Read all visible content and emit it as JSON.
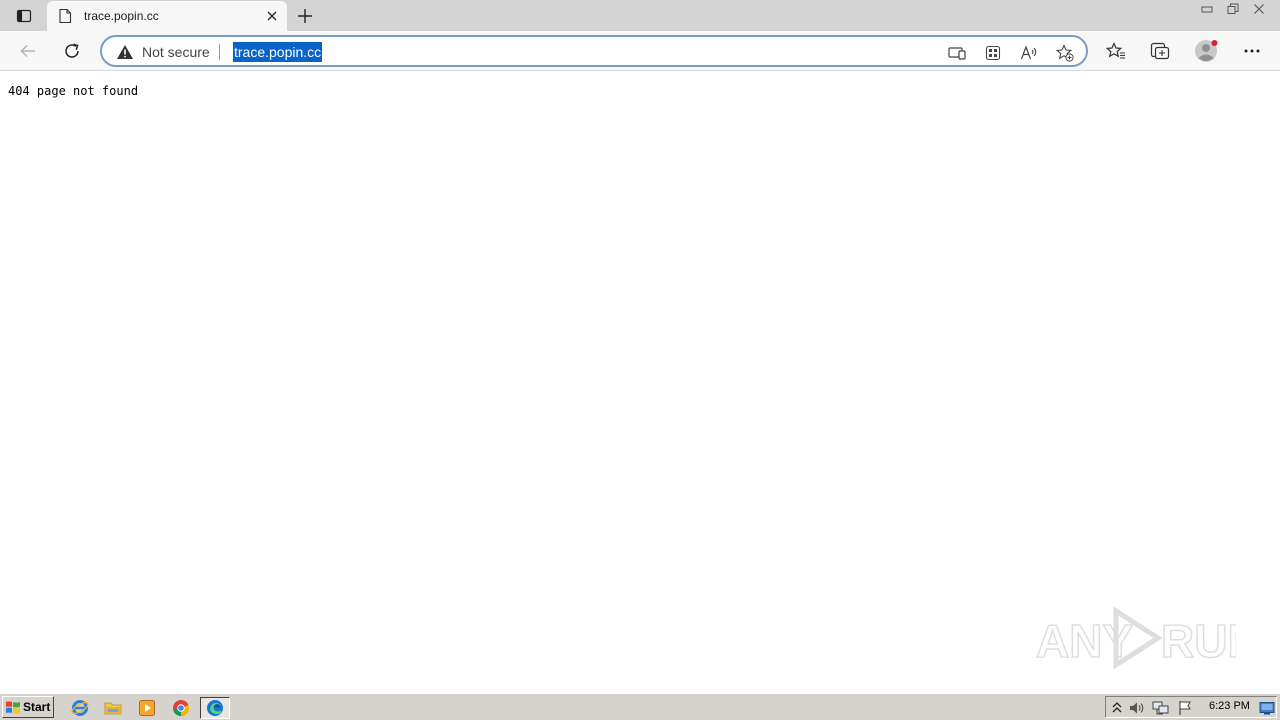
{
  "tab": {
    "title": "trace.popin.cc"
  },
  "addressbar": {
    "security_label": "Not secure",
    "url": "trace.popin.cc"
  },
  "page": {
    "message": "404 page not found"
  },
  "taskbar": {
    "start_label": "Start",
    "clock": "6:23 PM"
  },
  "watermark": {
    "text": "ANY RUN"
  },
  "icons": {
    "tab_actions": "tab-actions-icon",
    "favicon": "page-icon",
    "close_tab": "close-icon",
    "new_tab": "plus-icon",
    "back": "back-arrow-icon",
    "refresh": "refresh-icon",
    "warning": "warning-triangle-icon",
    "app_available": "app-available-icon",
    "extensions": "grid-icon",
    "read_aloud": "read-aloud-icon",
    "add_favorite": "star-add-icon",
    "favorites": "favorites-icon",
    "collections": "collections-icon",
    "profile": "profile-avatar-icon",
    "more": "more-dots-icon"
  },
  "colors": {
    "selection": "#0a63c8",
    "accent_border": "#7a9cc4"
  }
}
